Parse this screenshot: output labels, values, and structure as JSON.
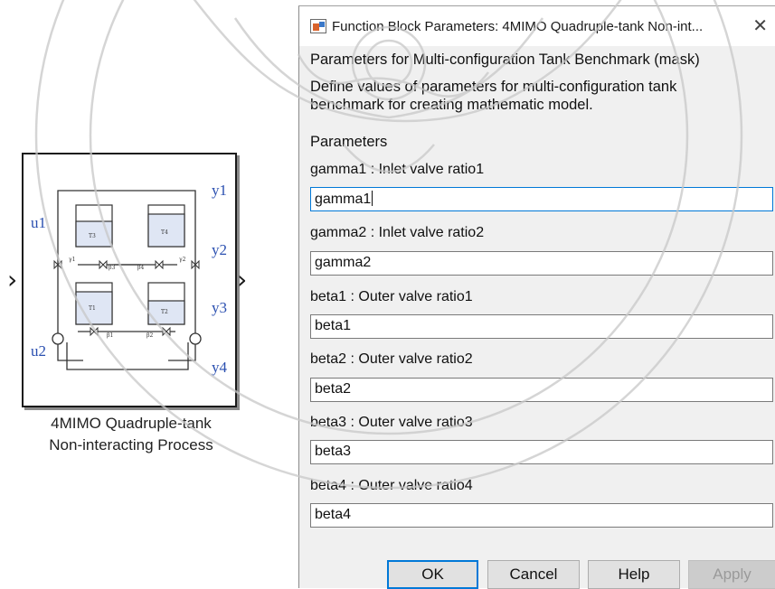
{
  "block": {
    "caption_line1": "4MIMO Quadruple-tank",
    "caption_line2": "Non-interacting Process",
    "inputs": [
      "u1",
      "u2"
    ],
    "outputs": [
      "y1",
      "y2",
      "y3",
      "y4"
    ],
    "tank_labels": [
      "T3",
      "T4",
      "T1",
      "T2"
    ],
    "valve_labels": [
      "γ1",
      "β3",
      "β4",
      "γ2",
      "β1",
      "β2"
    ]
  },
  "dialog": {
    "title": "Function Block Parameters: 4MIMO Quadruple-tank Non-int...",
    "heading": "Parameters for Multi-configuration Tank Benchmark (mask)",
    "description_line1": "Define values of parameters for multi-configuration tank",
    "description_line2": "benchmark for creating mathematic model.",
    "section_label": "Parameters",
    "params": [
      {
        "label": "gamma1 : Inlet valve ratio1",
        "value": "gamma1"
      },
      {
        "label": "gamma2 : Inlet valve ratio2",
        "value": "gamma2"
      },
      {
        "label": "beta1 : Outer valve ratio1",
        "value": "beta1"
      },
      {
        "label": "beta2 : Outer valve ratio2",
        "value": "beta2"
      },
      {
        "label": "beta3 : Outer valve ratio3",
        "value": "beta3"
      },
      {
        "label": "beta4 : Outer valve ratio4",
        "value": "beta4"
      }
    ],
    "buttons": {
      "ok": "OK",
      "cancel": "Cancel",
      "help": "Help",
      "apply": "Apply"
    }
  },
  "colors": {
    "accent": "#0078d7",
    "port_label": "#2a4fb0",
    "watermark": "#c8c8c8"
  }
}
